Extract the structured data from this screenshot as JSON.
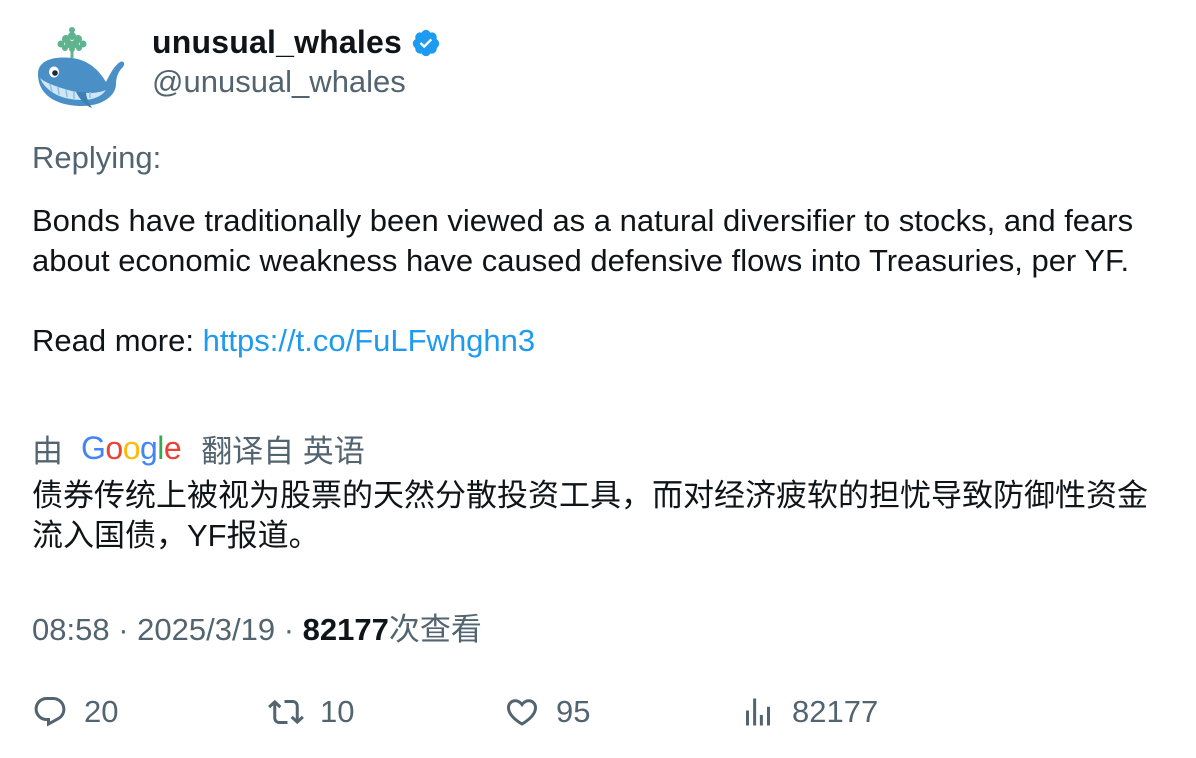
{
  "author": {
    "display_name": "unusual_whales",
    "handle": "@unusual_whales",
    "verified_color": "#1d9bf0",
    "avatar_icon": "whale-icon"
  },
  "tweet": {
    "replying_label": "Replying:",
    "body": "Bonds have traditionally been viewed as a natural diversifier to stocks, and fears about economic weakness have caused defensive flows into Treasuries, per YF.",
    "read_more_label": "Read more: ",
    "link": "https://t.co/FuLFwhghn3"
  },
  "translation": {
    "prefix": "由",
    "provider": "Google",
    "suffix": "翻译自 英语",
    "text": "债券传统上被视为股票的天然分散投资工具，而对经济疲软的担忧导致防御性资金流入国债，YF报道。"
  },
  "meta": {
    "time": "08:58",
    "separator": "·",
    "date": "2025/3/19",
    "views_count": "82177",
    "views_label": "次查看"
  },
  "actions": {
    "replies": "20",
    "retweets": "10",
    "likes": "95",
    "views": "82177"
  },
  "colors": {
    "text_primary": "#0f1419",
    "text_secondary": "#536471",
    "link": "#1d9bf0"
  }
}
